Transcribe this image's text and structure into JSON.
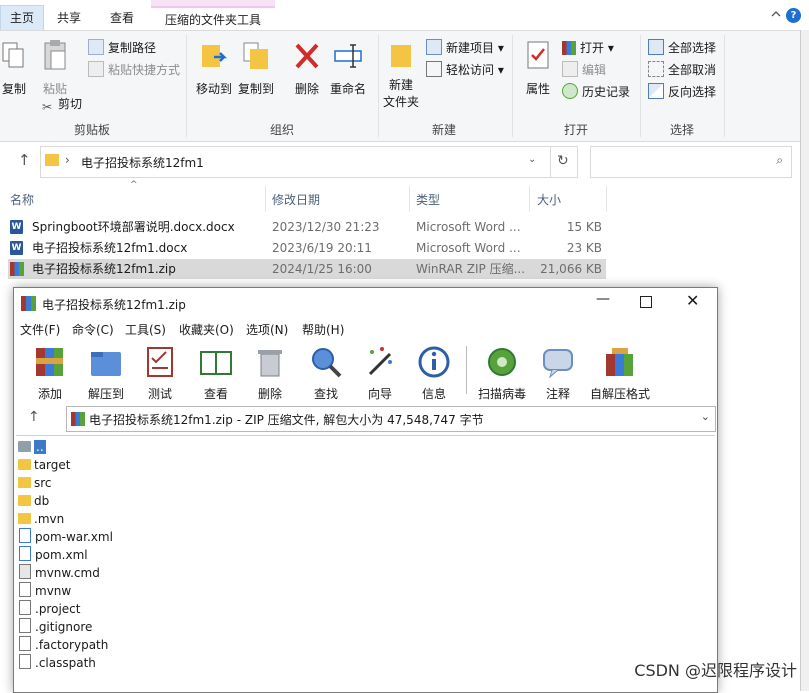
{
  "explorer": {
    "tabs": {
      "home": "主页",
      "share": "共享",
      "view": "查看",
      "compressed_tools": "压缩的文件夹工具"
    },
    "clipboard": {
      "copy": "复制",
      "paste": "粘贴",
      "copy_path": "复制路径",
      "paste_shortcut": "粘贴快捷方式",
      "cut": "剪切",
      "group": "剪贴板"
    },
    "organize": {
      "move_to": "移动到",
      "copy_to": "复制到",
      "delete": "删除",
      "rename": "重命名",
      "group": "组织"
    },
    "new": {
      "new_item": "新建项目",
      "easy_access": "轻松访问",
      "new_folder_1": "新建",
      "new_folder_2": "文件夹",
      "group": "新建"
    },
    "open": {
      "properties": "属性",
      "open": "打开",
      "edit": "编辑",
      "history": "历史记录",
      "group": "打开"
    },
    "select": {
      "select_all": "全部选择",
      "select_none": "全部取消",
      "invert": "反向选择",
      "group": "选择"
    },
    "address": {
      "path": "电子招投标系统12fm1"
    },
    "columns": {
      "name": "名称",
      "date": "修改日期",
      "type": "类型",
      "size": "大小"
    },
    "files": [
      {
        "name": "Springboot环境部署说明.docx.docx",
        "date": "2023/12/30 21:23",
        "type": "Microsoft Word ...",
        "size": "15 KB"
      },
      {
        "name": "电子招投标系统12fm1.docx",
        "date": "2023/6/19 20:11",
        "type": "Microsoft Word ...",
        "size": "23 KB"
      },
      {
        "name": "电子招投标系统12fm1.zip",
        "date": "2024/1/25 16:00",
        "type": "WinRAR ZIP 压缩...",
        "size": "21,066 KB"
      }
    ]
  },
  "winrar": {
    "title": "电子招投标系统12fm1.zip",
    "menu": [
      "文件(F)",
      "命令(C)",
      "工具(S)",
      "收藏夹(O)",
      "选项(N)",
      "帮助(H)"
    ],
    "toolbar": [
      "添加",
      "解压到",
      "测试",
      "查看",
      "删除",
      "查找",
      "向导",
      "信息",
      "扫描病毒",
      "注释",
      "自解压格式"
    ],
    "path_text": "电子招投标系统12fm1.zip - ZIP 压缩文件, 解包大小为 47,548,747 字节",
    "entries": [
      "..",
      "target",
      "src",
      "db",
      ".mvn",
      "pom-war.xml",
      "pom.xml",
      "mvnw.cmd",
      "mvnw",
      ".project",
      ".gitignore",
      ".factorypath",
      ".classpath"
    ]
  },
  "watermark": "CSDN @迟限程序设计"
}
